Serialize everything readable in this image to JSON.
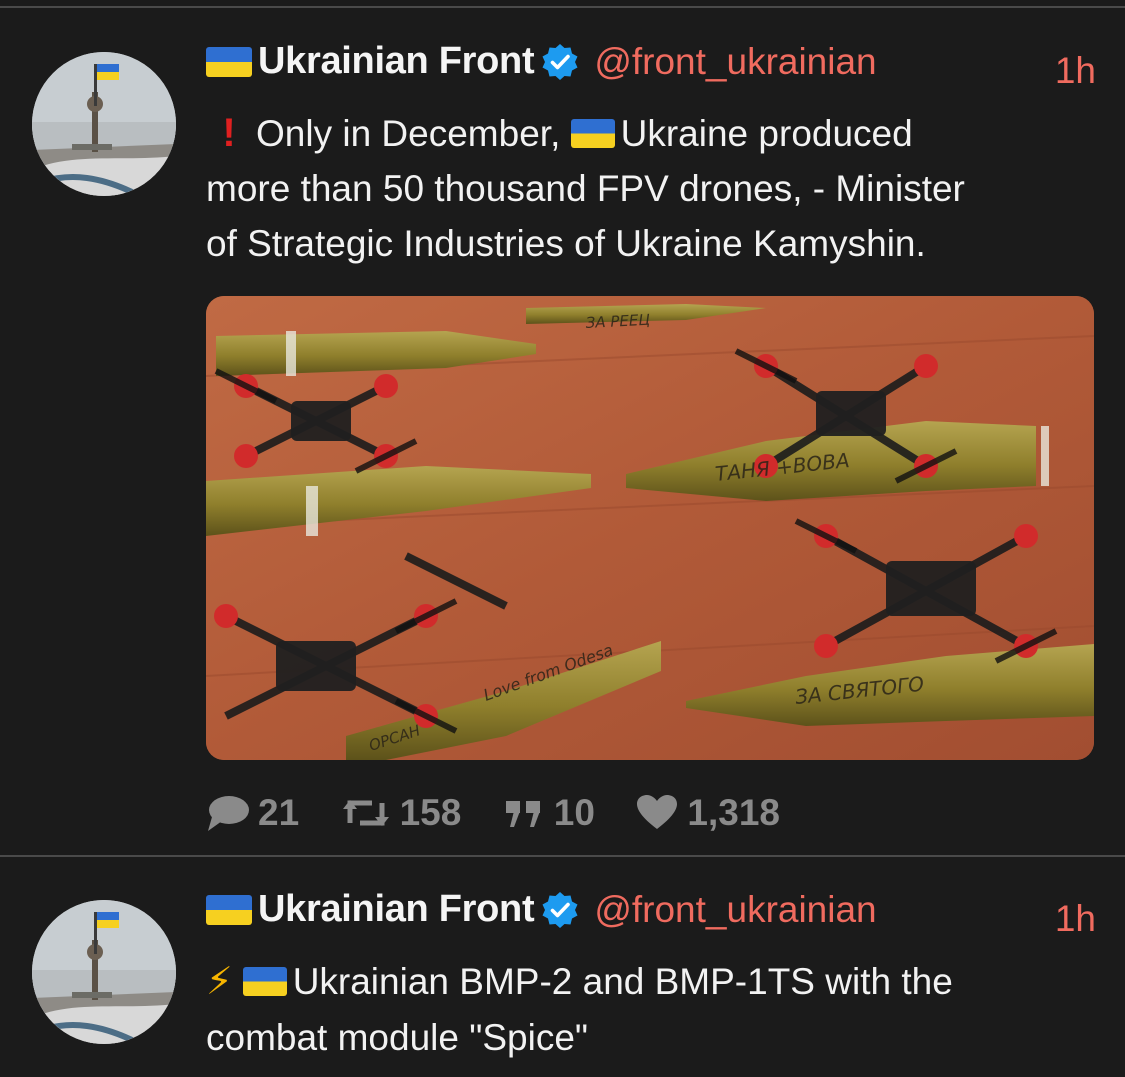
{
  "tweets": [
    {
      "author": {
        "name": "Ukrainian Front",
        "handle": "@front_ukrainian",
        "verified": true
      },
      "time": "1h",
      "text": {
        "line1_a": "Only in December,",
        "line1_b": "Ukraine produced",
        "line2": "more than 50 thousand FPV drones, - Minister",
        "line3": "of Strategic Industries of Ukraine Kamyshin."
      },
      "media": {
        "inscriptions": [
          "ТАНЯ +ВОВА",
          "ЗА СВЯТОГО",
          "Love from Odesa",
          "ОРСАН",
          "ЗА РЕЕЦ"
        ]
      },
      "actions": {
        "replies": "21",
        "retweets": "158",
        "quotes": "10",
        "likes": "1,318"
      }
    },
    {
      "author": {
        "name": "Ukrainian Front",
        "handle": "@front_ukrainian",
        "verified": true
      },
      "time": "1h",
      "text": {
        "line1": "Ukrainian BMP-2 and BMP-1TS with the",
        "line2": "combat module \"Spice\""
      }
    }
  ],
  "colors": {
    "background": "#1b1b1b",
    "accent": "#f06b5f",
    "verified": "#1d9bf0",
    "muted": "#8a8a8a"
  },
  "icons": [
    "flag-ukraine-icon",
    "verified-badge-icon",
    "exclamation-icon",
    "lightning-icon",
    "reply-icon",
    "retweet-icon",
    "quote-icon",
    "like-icon"
  ]
}
